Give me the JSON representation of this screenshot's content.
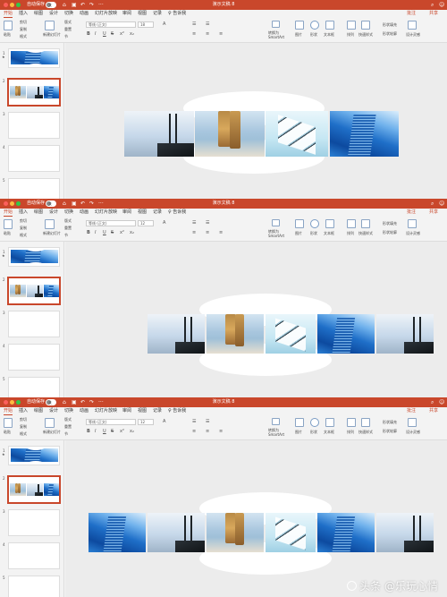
{
  "window": {
    "title": "演示文稿 8",
    "autosave_label": "自动保存",
    "autosave_state": "关",
    "colors": {
      "titlebar": "#c9472b",
      "accent": "#c9472b",
      "canvas": "#ececec"
    }
  },
  "tabs": [
    "开始",
    "插入",
    "绘图",
    "设计",
    "切换",
    "动画",
    "幻灯片放映",
    "审阅",
    "视图",
    "记录",
    "♀ 告诉我"
  ],
  "active_tab": "开始",
  "right_actions": {
    "comment": "批注",
    "share": "共享"
  },
  "ribbon": {
    "paste": "粘贴",
    "cut": "剪切",
    "copy": "复制",
    "format": "格式",
    "new_slide": "新建幻灯片",
    "layout": "版式",
    "reset": "重置",
    "section": "节",
    "font_name": "等线 (正文)",
    "font_size_a": "18",
    "font_size_b": "12",
    "format_buttons": [
      "B",
      "I",
      "U",
      "S",
      "x²",
      "x₂"
    ],
    "convert_smartart": "转换为 SmartArt",
    "picture": "图片",
    "shapes": "形状",
    "textbox": "文本框",
    "arrange": "排列",
    "quick_styles": "快速样式",
    "shape_fill": "形状填充",
    "shape_outline": "形状轮廓",
    "designer": "设计灵感"
  },
  "panels": [
    {
      "slides": [
        {
          "number": "1",
          "star": "★"
        },
        {
          "number": "2"
        },
        {
          "number": "3"
        },
        {
          "number": "4"
        },
        {
          "number": "5"
        }
      ],
      "selected_slide": "2",
      "main_photos": [
        "bridge",
        "beach",
        "dice",
        "city"
      ]
    },
    {
      "slides": [
        {
          "number": "1",
          "star": "★"
        },
        {
          "number": "2"
        },
        {
          "number": "3"
        },
        {
          "number": "4"
        },
        {
          "number": "5"
        }
      ],
      "selected_slide": "2",
      "main_photos": [
        "bridge",
        "beach",
        "dice",
        "city",
        "bridge"
      ]
    },
    {
      "slides": [
        {
          "number": "1",
          "star": "★"
        },
        {
          "number": "2"
        },
        {
          "number": "3"
        },
        {
          "number": "4"
        },
        {
          "number": "5"
        }
      ],
      "selected_slide": "2",
      "main_photos": [
        "city",
        "bridge",
        "beach",
        "dice",
        "city",
        "bridge"
      ]
    }
  ],
  "watermark": "头条 @乐玩心情"
}
